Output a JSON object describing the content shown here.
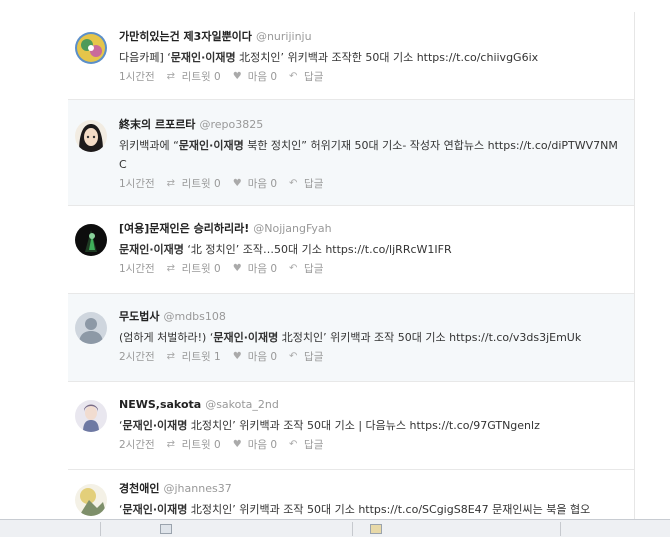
{
  "tweets": [
    {
      "name": "가만히있는건 제3자일뿐이다",
      "handle": "@nurijinju",
      "text_pre": "다음카페] ‘",
      "text_bold": "문재인·이재명",
      "text_post": " 北정치인’ 위키백과 조작한 50대 기소 https://t.co/chiivgG6ix",
      "time": "1시간전",
      "retweet_label": "리트윗",
      "retweet_count": "0",
      "like_label": "마음",
      "like_count": "0",
      "reply_label": "답글"
    },
    {
      "name": "終末의 르포르타",
      "handle": "@repo3825",
      "text_pre": "위키백과에 “",
      "text_bold": "문재인·이재명",
      "text_post": " 북한 정치인” 허위기재 50대 기소- 작성자 연합뉴스 https://t.co/diPTWV7NMC",
      "time": "1시간전",
      "retweet_label": "리트윗",
      "retweet_count": "0",
      "like_label": "마음",
      "like_count": "0",
      "reply_label": "답글"
    },
    {
      "name": "[여용]문재인은 승리하리라!",
      "handle": "@NojjangFyah",
      "text_pre": "",
      "text_bold": "문재인·이재명",
      "text_post": " ‘北 정치인’ 조작…50대 기소 https://t.co/ljRRcW1IFR",
      "time": "1시간전",
      "retweet_label": "리트윗",
      "retweet_count": "0",
      "like_label": "마음",
      "like_count": "0",
      "reply_label": "답글"
    },
    {
      "name": "무도법사",
      "handle": "@mdbs108",
      "text_pre": "(엄하게 처벌하라!) ‘",
      "text_bold": "문재인·이재명",
      "text_post": " 北정치인’ 위키백과 조작 50대 기소 https://t.co/v3ds3jEmUk",
      "time": "2시간전",
      "retweet_label": "리트윗",
      "retweet_count": "1",
      "like_label": "마음",
      "like_count": "0",
      "reply_label": "답글"
    },
    {
      "name": "NEWS,sakota",
      "handle": "@sakota_2nd",
      "text_pre": "‘",
      "text_bold": "문재인·이재명",
      "text_post": " 北정치인’ 위키백과 조작 50대 기소 | 다음뉴스 https://t.co/97GTNgenlz",
      "time": "2시간전",
      "retweet_label": "리트윗",
      "retweet_count": "0",
      "like_label": "마음",
      "like_count": "0",
      "reply_label": "답글"
    },
    {
      "name": "경천애인",
      "handle": "@jhannes37",
      "text_pre": "‘",
      "text_bold": "문재인·이재명",
      "text_post": " 北정치인’ 위키백과 조작 50대 기소 https://t.co/SCgigS8E47 문재인씨는 북을 협오",
      "time": "",
      "retweet_label": "",
      "retweet_count": "",
      "like_label": "",
      "like_count": "",
      "reply_label": ""
    }
  ],
  "icons": {
    "retweet": "retweet-icon",
    "like": "heart-icon",
    "reply": "reply-icon"
  },
  "colors": {
    "alt_row": "#f5f8fa",
    "muted": "#999999"
  }
}
